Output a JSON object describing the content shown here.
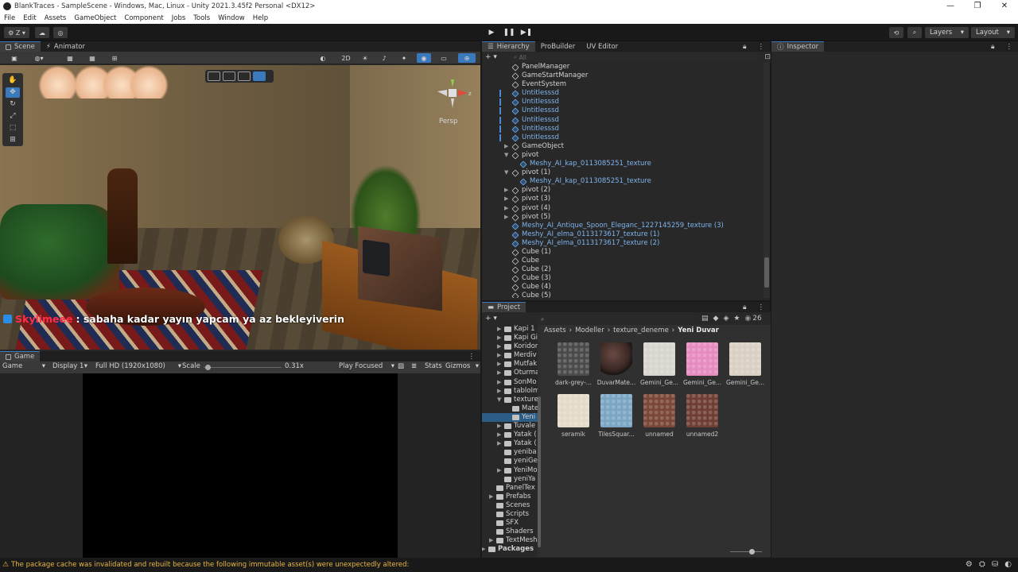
{
  "window": {
    "title": "BlankTraces - SampleScene - Windows, Mac, Linux - Unity 2021.3.45f2 Personal <DX12>",
    "controls": [
      "—",
      "❐",
      "✕"
    ]
  },
  "menu": [
    "File",
    "Edit",
    "Assets",
    "GameObject",
    "Component",
    "Jobs",
    "Tools",
    "Window",
    "Help"
  ],
  "toolbar": {
    "account_label": "Z",
    "layers_label": "Layers",
    "layout_label": "Layout"
  },
  "scene_panel": {
    "tabs": [
      "Scene",
      "Animator"
    ],
    "mode_2d": "2D",
    "persp_label": "Persp",
    "chat": {
      "user": "Skylimeee",
      "message": ": sabaha kadar yayın yapcam ya az bekleyiverin"
    }
  },
  "game_panel": {
    "tab": "Game",
    "mode": "Game",
    "display": "Display 1",
    "resolution": "Full HD (1920x1080)",
    "scale_label": "Scale",
    "scale_value": "0.31x",
    "scale_fraction": 0.06,
    "play_focused": "Play Focused",
    "stats": "Stats",
    "gizmos": "Gizmos"
  },
  "hierarchy": {
    "tabs": [
      "Hierarchy",
      "ProBuilder",
      "UV Editor"
    ],
    "search_placeholder": "All",
    "items": [
      {
        "label": "PanelManager",
        "depth": 0,
        "prefab": false,
        "arrow": ""
      },
      {
        "label": "GameStartManager",
        "depth": 0,
        "prefab": false,
        "arrow": ""
      },
      {
        "label": "EventSystem",
        "depth": 0,
        "prefab": false,
        "arrow": ""
      },
      {
        "label": "Untitlesssd",
        "depth": 0,
        "prefab": true,
        "arrow": "",
        "bar": true
      },
      {
        "label": "Untitlesssd",
        "depth": 0,
        "prefab": true,
        "arrow": "",
        "bar": true
      },
      {
        "label": "Untitlesssd",
        "depth": 0,
        "prefab": true,
        "arrow": "",
        "bar": true
      },
      {
        "label": "Untitlesssd",
        "depth": 0,
        "prefab": true,
        "arrow": "",
        "bar": true
      },
      {
        "label": "Untitlesssd",
        "depth": 0,
        "prefab": true,
        "arrow": "",
        "bar": true
      },
      {
        "label": "Untitlesssd",
        "depth": 0,
        "prefab": true,
        "arrow": "",
        "bar": true
      },
      {
        "label": "GameObject",
        "depth": 0,
        "prefab": false,
        "arrow": "▶"
      },
      {
        "label": "pivot",
        "depth": 0,
        "prefab": false,
        "arrow": "▼"
      },
      {
        "label": "Meshy_AI_kap_0113085251_texture",
        "depth": 1,
        "prefab": true,
        "arrow": ""
      },
      {
        "label": "pivot (1)",
        "depth": 0,
        "prefab": false,
        "arrow": "▼"
      },
      {
        "label": "Meshy_AI_kap_0113085251_texture",
        "depth": 1,
        "prefab": true,
        "arrow": ""
      },
      {
        "label": "pivot (2)",
        "depth": 0,
        "prefab": false,
        "arrow": "▶"
      },
      {
        "label": "pivot (3)",
        "depth": 0,
        "prefab": false,
        "arrow": "▶"
      },
      {
        "label": "pivot (4)",
        "depth": 0,
        "prefab": false,
        "arrow": "▶"
      },
      {
        "label": "pivot (5)",
        "depth": 0,
        "prefab": false,
        "arrow": "▶"
      },
      {
        "label": "Meshy_AI_Antique_Spoon_Eleganc_1227145259_texture (3)",
        "depth": 0,
        "prefab": true,
        "arrow": ""
      },
      {
        "label": "Meshy_AI_elma_0113173617_texture (1)",
        "depth": 0,
        "prefab": true,
        "arrow": ""
      },
      {
        "label": "Meshy_AI_elma_0113173617_texture (2)",
        "depth": 0,
        "prefab": true,
        "arrow": ""
      },
      {
        "label": "Cube (1)",
        "depth": 0,
        "prefab": false,
        "arrow": ""
      },
      {
        "label": "Cube",
        "depth": 0,
        "prefab": false,
        "arrow": ""
      },
      {
        "label": "Cube (2)",
        "depth": 0,
        "prefab": false,
        "arrow": ""
      },
      {
        "label": "Cube (3)",
        "depth": 0,
        "prefab": false,
        "arrow": ""
      },
      {
        "label": "Cube (4)",
        "depth": 0,
        "prefab": false,
        "arrow": ""
      },
      {
        "label": "Cube (5)",
        "depth": 0,
        "prefab": false,
        "arrow": ""
      }
    ]
  },
  "inspector": {
    "tab": "Inspector"
  },
  "project": {
    "tab": "Project",
    "count": "26",
    "breadcrumb": [
      "Assets",
      "Modeller",
      "texture_deneme",
      "Yeni Duvar"
    ],
    "tree": [
      {
        "label": "Kapi 1",
        "depth": 2,
        "arrow": "▶"
      },
      {
        "label": "Kapi Gi",
        "depth": 2,
        "arrow": "▶"
      },
      {
        "label": "Koridor",
        "depth": 2,
        "arrow": "▶"
      },
      {
        "label": "Merdiv",
        "depth": 2,
        "arrow": "▶"
      },
      {
        "label": "Mutfak",
        "depth": 2,
        "arrow": "▶"
      },
      {
        "label": "Oturma",
        "depth": 2,
        "arrow": "▶"
      },
      {
        "label": "SonMo",
        "depth": 2,
        "arrow": "▶"
      },
      {
        "label": "tabloIm",
        "depth": 2,
        "arrow": "▶"
      },
      {
        "label": "texture",
        "depth": 2,
        "arrow": "▼"
      },
      {
        "label": "Mate",
        "depth": 3,
        "arrow": ""
      },
      {
        "label": "Yeni",
        "depth": 3,
        "arrow": "",
        "selected": true
      },
      {
        "label": "Tuvale",
        "depth": 2,
        "arrow": "▶"
      },
      {
        "label": "Yatak (",
        "depth": 2,
        "arrow": "▶"
      },
      {
        "label": "Yatak (",
        "depth": 2,
        "arrow": "▶"
      },
      {
        "label": "yeniba",
        "depth": 2,
        "arrow": ""
      },
      {
        "label": "yeniGe",
        "depth": 2,
        "arrow": ""
      },
      {
        "label": "YeniMo",
        "depth": 2,
        "arrow": "▶"
      },
      {
        "label": "yeniYa",
        "depth": 2,
        "arrow": ""
      },
      {
        "label": "PanelTex",
        "depth": 1,
        "arrow": ""
      },
      {
        "label": "Prefabs",
        "depth": 1,
        "arrow": "▶"
      },
      {
        "label": "Scenes",
        "depth": 1,
        "arrow": ""
      },
      {
        "label": "Scripts",
        "depth": 1,
        "arrow": ""
      },
      {
        "label": "SFX",
        "depth": 1,
        "arrow": ""
      },
      {
        "label": "Shaders",
        "depth": 1,
        "arrow": ""
      },
      {
        "label": "TextMesh",
        "depth": 1,
        "arrow": "▶"
      },
      {
        "label": "Packages",
        "depth": 0,
        "arrow": "▶",
        "bold": true
      }
    ],
    "assets": [
      {
        "label": "dark-grey-...",
        "color": "#4a4a4a"
      },
      {
        "label": "DuvarMate...",
        "color": "#3a2824",
        "sphere": true
      },
      {
        "label": "Gemini_Ge...",
        "color": "#d8d4ce"
      },
      {
        "label": "Gemini_Ge...",
        "color": "#e58bc0"
      },
      {
        "label": "Gemini_Ge...",
        "color": "#d9cfc3"
      },
      {
        "label": "seramik",
        "color": "#e4dac8"
      },
      {
        "label": "TilesSquar...",
        "color": "#7aa6c4"
      },
      {
        "label": "unnamed",
        "color": "#7a4638"
      },
      {
        "label": "unnamed2",
        "color": "#6e3e34"
      }
    ]
  },
  "status": {
    "message": "The package cache was invalidated and rebuilt because the following immutable asset(s) were unexpectedly altered:"
  }
}
